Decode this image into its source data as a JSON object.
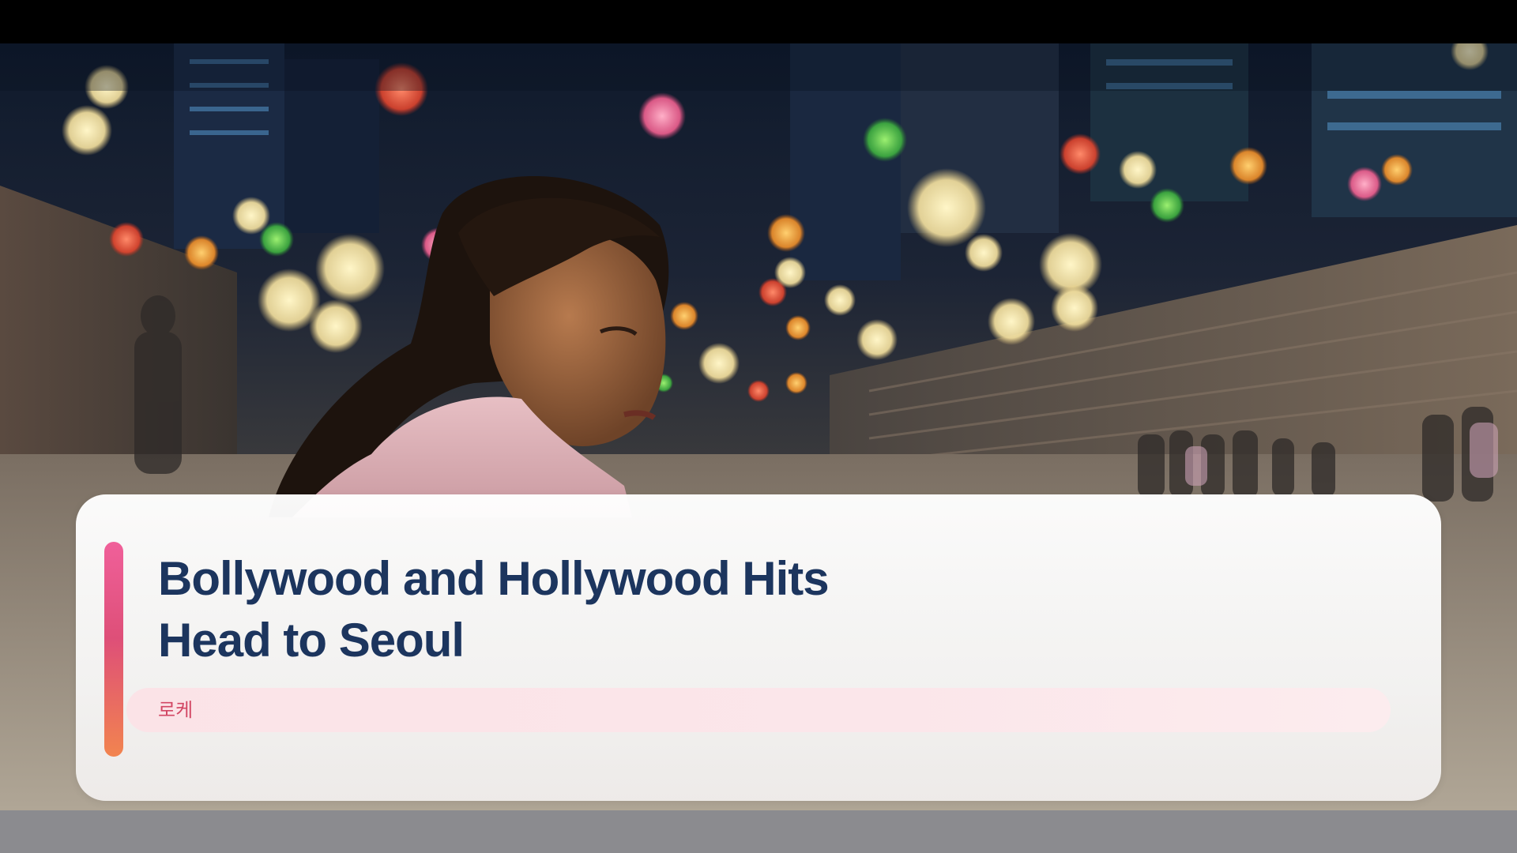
{
  "headline": {
    "line1": "Bollywood and Hollywood Hits",
    "line2": "Head to Seoul"
  },
  "tag": {
    "label": "로케"
  },
  "colors": {
    "headline": "#1c355e",
    "accent_top": "#f0609a",
    "accent_bottom": "#f2844f",
    "tag_text": "#d24764",
    "tag_bg": "#fbe3e7"
  }
}
